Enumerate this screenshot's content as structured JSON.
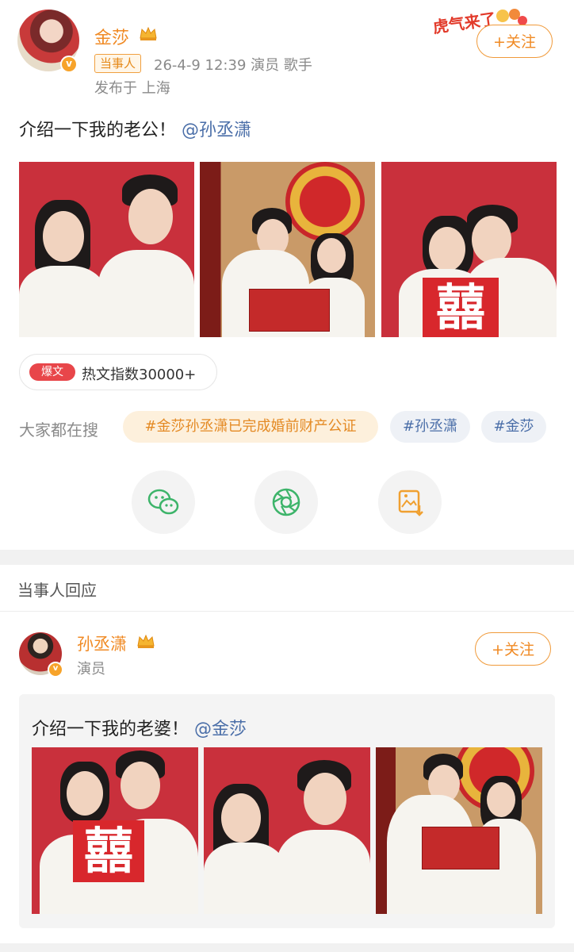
{
  "post": {
    "username": "金莎",
    "badge": "当事人",
    "meta": "26-4-9 12:39  演员 歌手",
    "location": "发布于 上海",
    "follow_label": "+关注",
    "text_main": "介绍一下我的老公！",
    "mention": "@孙丞潇",
    "sticker_text": "虎气来了",
    "hot_badge": "爆文",
    "hot_text": "热文指数30000+",
    "search_label": "大家都在搜",
    "search_tags": [
      "#金莎孙丞潇已完成婚前财产公证",
      "#孙丞潇",
      "#金莎"
    ],
    "share_icons": [
      "wechat-icon",
      "moments-icon",
      "save-image-icon"
    ],
    "xi_char": "囍"
  },
  "section": {
    "title": "当事人回应"
  },
  "reply": {
    "username": "孙丞潇",
    "role": "演员",
    "follow_label": "+关注",
    "text_main": "介绍一下我的老婆！",
    "mention": "@金莎"
  },
  "colors": {
    "accent": "#f08a24",
    "link": "#4a6ea8",
    "wedding_red": "#c9303c"
  }
}
